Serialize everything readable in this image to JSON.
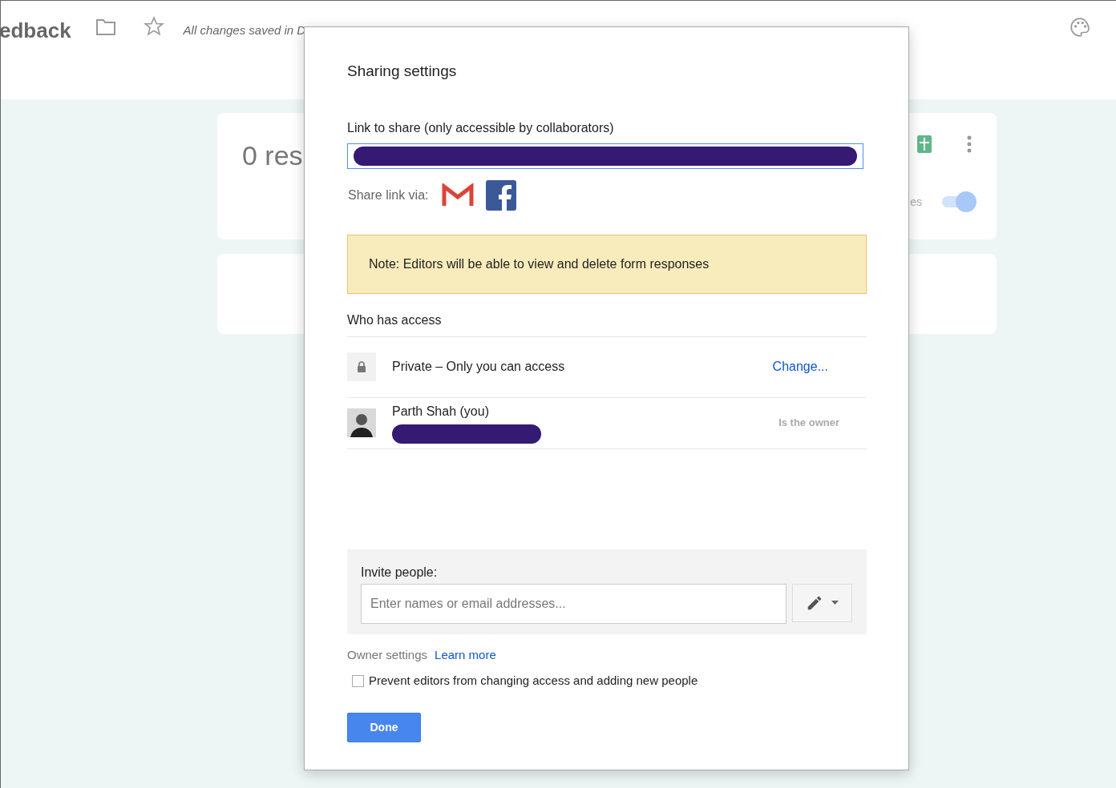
{
  "app_header": {
    "title": "edback",
    "status": "All changes saved in D"
  },
  "summary_card": {
    "count": "0 res",
    "toggle_label": "es",
    "toggle": {
      "on": true
    }
  },
  "dialog": {
    "title": "Sharing settings",
    "link_label": "Link to share (only accessible by collaborators)",
    "share_via_label": "Share link via:",
    "note": "Note: Editors will be able to view and delete form responses",
    "access_heading": "Who has access",
    "access_rows": [
      {
        "kind": "visibility",
        "label": "Private – Only you can access",
        "action": "Change..."
      },
      {
        "kind": "person",
        "name": "Parth Shah (you)",
        "role": "Is the owner"
      }
    ],
    "invite": {
      "label": "Invite people:",
      "placeholder": "Enter names or email addresses..."
    },
    "owner_settings": {
      "label": "Owner settings",
      "link": "Learn more"
    },
    "prevent_editors": {
      "label": "Prevent editors from changing access and adding new people",
      "checked": false
    },
    "done": "Done"
  }
}
